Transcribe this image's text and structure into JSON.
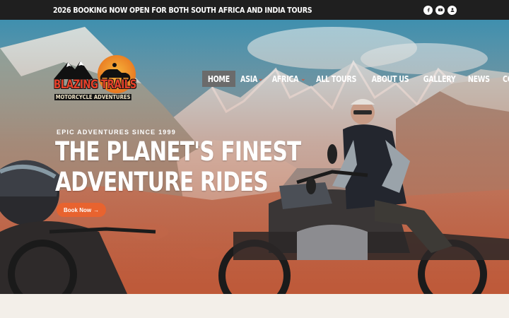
{
  "announcement": {
    "text": "2026 BOOKING NOW OPEN FOR BOTH SOUTH AFRICA AND INDIA TOURS"
  },
  "social": [
    {
      "icon": "facebook-icon"
    },
    {
      "icon": "youtube-icon"
    },
    {
      "icon": "user-icon"
    }
  ],
  "logo": {
    "title": "BLAZING TRAILS",
    "subtitle": "MOTORCYCLE ADVENTURES"
  },
  "nav": {
    "items": [
      {
        "label": "HOME",
        "active": true,
        "dropdown": false
      },
      {
        "label": "ASIA",
        "active": false,
        "dropdown": true
      },
      {
        "label": "AFRICA",
        "active": false,
        "dropdown": true
      },
      {
        "label": "ALL TOURS",
        "active": false,
        "dropdown": false
      },
      {
        "label": "ABOUT US",
        "active": false,
        "dropdown": false
      },
      {
        "label": "GALLERY",
        "active": false,
        "dropdown": false
      },
      {
        "label": "NEWS",
        "active": false,
        "dropdown": false
      },
      {
        "label": "CONTACT",
        "active": false,
        "dropdown": false
      }
    ],
    "dropdown_glyph": "⌄"
  },
  "hero": {
    "eyebrow": "EPIC ADVENTURES SINCE 1999",
    "headline_line1": "THE PLANET'S FINEST",
    "headline_line2": "ADVENTURE RIDES",
    "cta": "Book Now",
    "cta_arrow": "→"
  },
  "colors": {
    "accent": "#e8632f",
    "nav_active_bg": "#6b6b6b",
    "topbar_bg": "#1f1f1f",
    "chevron": "#e44b2a"
  }
}
